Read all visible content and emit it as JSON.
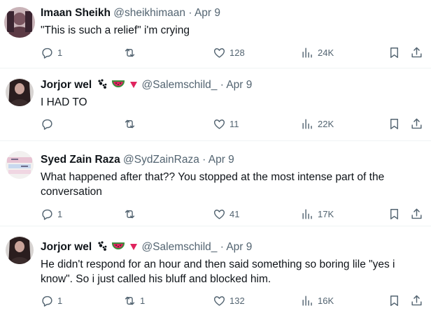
{
  "colors": {
    "text": "#0f1419",
    "secondary": "#536471",
    "divider": "#eff3f4",
    "emoji_watermelon": "#e0245e",
    "emoji_triangle": "#e0245e"
  },
  "tweets": [
    {
      "name": "Imaan Sheikh",
      "handle": "@sheikhimaan",
      "dot": "·",
      "date": "Apr 9",
      "text": "\"This is such a relief\" i'm crying",
      "replies": "1",
      "retweets": "",
      "likes": "128",
      "views": "24K"
    },
    {
      "name": "Jorjor wel",
      "handle": "@Salemschild_",
      "dot": "·",
      "date": "Apr 9",
      "text": "I HAD TO",
      "replies": "",
      "retweets": "",
      "likes": "11",
      "views": "22K",
      "emojis": [
        "paw-prints",
        "watermelon",
        "red-triangle"
      ]
    },
    {
      "name": "Syed Zain Raza",
      "handle": "@SydZainRaza",
      "dot": "·",
      "date": "Apr 9",
      "text": "What happened after that?? You stopped at the most intense part of the conversation",
      "replies": "1",
      "retweets": "",
      "likes": "41",
      "views": "17K"
    },
    {
      "name": "Jorjor wel",
      "handle": "@Salemschild_",
      "dot": "·",
      "date": "Apr 9",
      "text": "He didn't respond for an hour and then said something so boring lile \"yes i know\". So i just called his bluff and blocked him.",
      "replies": "1",
      "retweets": "1",
      "likes": "132",
      "views": "16K",
      "emojis": [
        "paw-prints",
        "watermelon",
        "red-triangle"
      ]
    }
  ]
}
